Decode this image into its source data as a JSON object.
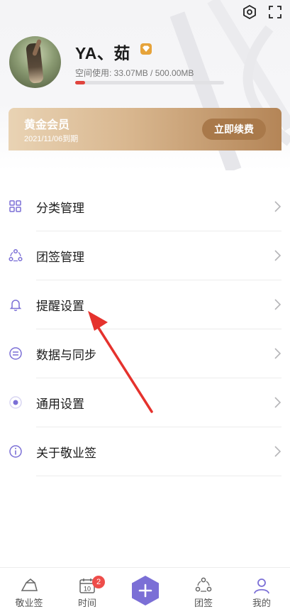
{
  "profile": {
    "name": "YA、茹",
    "storage_text": "空间使用: 33.07MB / 500.00MB",
    "storage_used_fraction": 0.066
  },
  "membership": {
    "title": "黄金会员",
    "expire": "2021/11/06到期",
    "renew_label": "立即续费"
  },
  "menu": {
    "items": [
      {
        "label": "分类管理",
        "icon": "category-grid-icon"
      },
      {
        "label": "团签管理",
        "icon": "team-icon"
      },
      {
        "label": "提醒设置",
        "icon": "bell-icon"
      },
      {
        "label": "数据与同步",
        "icon": "sync-icon"
      },
      {
        "label": "通用设置",
        "icon": "general-settings-icon"
      },
      {
        "label": "关于敬业签",
        "icon": "info-icon"
      }
    ]
  },
  "tabbar": {
    "tabs": [
      {
        "label": "敬业签",
        "icon": "notes-icon"
      },
      {
        "label": "时间",
        "icon": "calendar-icon",
        "badge": "2",
        "calendar_day": "10"
      },
      {
        "label": "",
        "icon": "add-icon"
      },
      {
        "label": "团签",
        "icon": "team-tab-icon"
      },
      {
        "label": "我的",
        "icon": "profile-icon"
      }
    ]
  },
  "colors": {
    "accent": "#7b6fd6",
    "badge": "#ee4d4a",
    "gold_dark": "#a9794a",
    "storage_fill": "#e0443e",
    "annotation_arrow": "#e5322d"
  }
}
